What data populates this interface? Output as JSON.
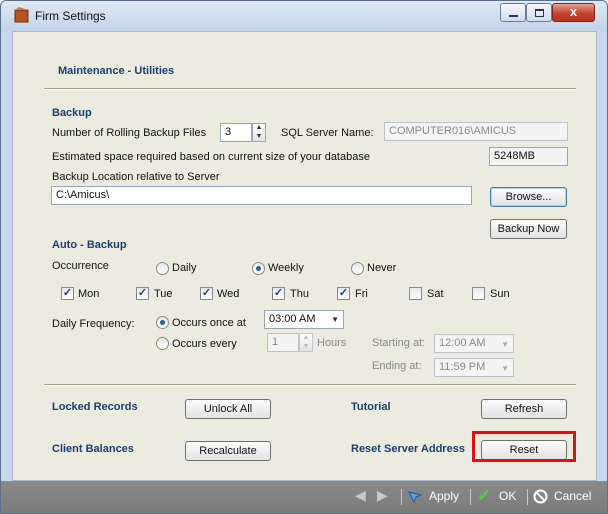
{
  "window": {
    "title": "Firm Settings",
    "close_glyph": "x"
  },
  "page": {
    "heading": "Maintenance - Utilities"
  },
  "backup": {
    "section_title": "Backup",
    "rolling_files_label": "Number of Rolling Backup Files",
    "rolling_files_value": "3",
    "sql_server_label": "SQL Server Name:",
    "sql_server_value": "COMPUTER016\\AMICUS",
    "estimated_label": "Estimated space required based on current size of your database",
    "estimated_value": "5248MB",
    "location_label": "Backup Location relative to Server",
    "location_value": "C:\\Amicus\\",
    "browse_label": "Browse...",
    "backup_now_label": "Backup Now"
  },
  "auto_backup": {
    "section_title": "Auto - Backup",
    "occurrence_label": "Occurrence",
    "occurrence_options": [
      "Daily",
      "Weekly",
      "Never"
    ],
    "occurrence_selected": "Weekly",
    "days": [
      {
        "label": "Mon",
        "checked": true
      },
      {
        "label": "Tue",
        "checked": true
      },
      {
        "label": "Wed",
        "checked": true
      },
      {
        "label": "Thu",
        "checked": true
      },
      {
        "label": "Fri",
        "checked": true
      },
      {
        "label": "Sat",
        "checked": false
      },
      {
        "label": "Sun",
        "checked": false
      }
    ],
    "frequency_label": "Daily Frequency:",
    "once_label": "Occurs once at",
    "once_time": "03:00 AM",
    "every_label": "Occurs every",
    "every_value": "1",
    "hours_label": "Hours",
    "starting_label": "Starting at:",
    "starting_value": "12:00 AM",
    "ending_label": "Ending at:",
    "ending_value": "11:59 PM"
  },
  "utilities": {
    "locked_label": "Locked Records",
    "unlock_label": "Unlock All",
    "tutorial_label": "Tutorial",
    "refresh_label": "Refresh",
    "client_balances_label": "Client Balances",
    "recalculate_label": "Recalculate",
    "reset_server_label": "Reset Server Address",
    "reset_label": "Reset"
  },
  "footer": {
    "apply_label": "Apply",
    "ok_label": "OK",
    "cancel_label": "Cancel"
  },
  "colors": {
    "section_title": "#1b3f6e",
    "highlight": "#e01010",
    "footer": "#808080"
  },
  "icons": [
    "app-icon",
    "minimize-icon",
    "maximize-icon",
    "close-icon",
    "back-arrow-icon",
    "forward-arrow-icon",
    "apply-icon",
    "ok-checkmark-icon",
    "cancel-icon",
    "spin-up-icon",
    "spin-down-icon",
    "dropdown-arrow-icon"
  ]
}
